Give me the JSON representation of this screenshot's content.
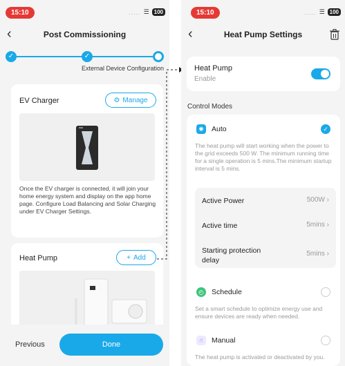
{
  "status": {
    "time": "15:10",
    "battery": "100"
  },
  "left": {
    "title": "Post Commissioning",
    "step_label": "External Device Configuration",
    "ev_card": {
      "title": "EV Charger",
      "manage": "Manage",
      "description": "Once the EV charger is connected, it will join your home energy system and display on the app home page. Configure Load Balancing and Solar Charging under EV Charger Settings."
    },
    "hp_card": {
      "title": "Heat Pump",
      "add": "Add"
    },
    "previous": "Previous",
    "done": "Done"
  },
  "right": {
    "title": "Heat Pump Settings",
    "enable_card": {
      "title": "Heat Pump",
      "subtitle": "Enable",
      "enabled": true
    },
    "control_modes_label": "Control Modes",
    "auto": {
      "label": "Auto",
      "selected": true,
      "description": "The heat pump will start working when the power to the grid exceeds 500 W. The minimum running time for a single operation is 5 mins.The minimum startup interval is 5 mins.",
      "rows": [
        {
          "label": "Active Power",
          "value": "500W"
        },
        {
          "label": "Active time",
          "value": "5mins"
        },
        {
          "label": "Starting protection delay",
          "value": "5mins"
        }
      ]
    },
    "schedule": {
      "label": "Schedule",
      "selected": false,
      "description": "Set a smart schedule to optimize energy use and ensure devices are ready when needed."
    },
    "manual": {
      "label": "Manual",
      "selected": false,
      "description": "The heat pump is activated or deactivated by you."
    }
  },
  "colors": {
    "accent": "#1aa9e8",
    "status_pill": "#e53935",
    "schedule_icon": "#3cc47c",
    "manual_icon": "#7b68ee"
  }
}
